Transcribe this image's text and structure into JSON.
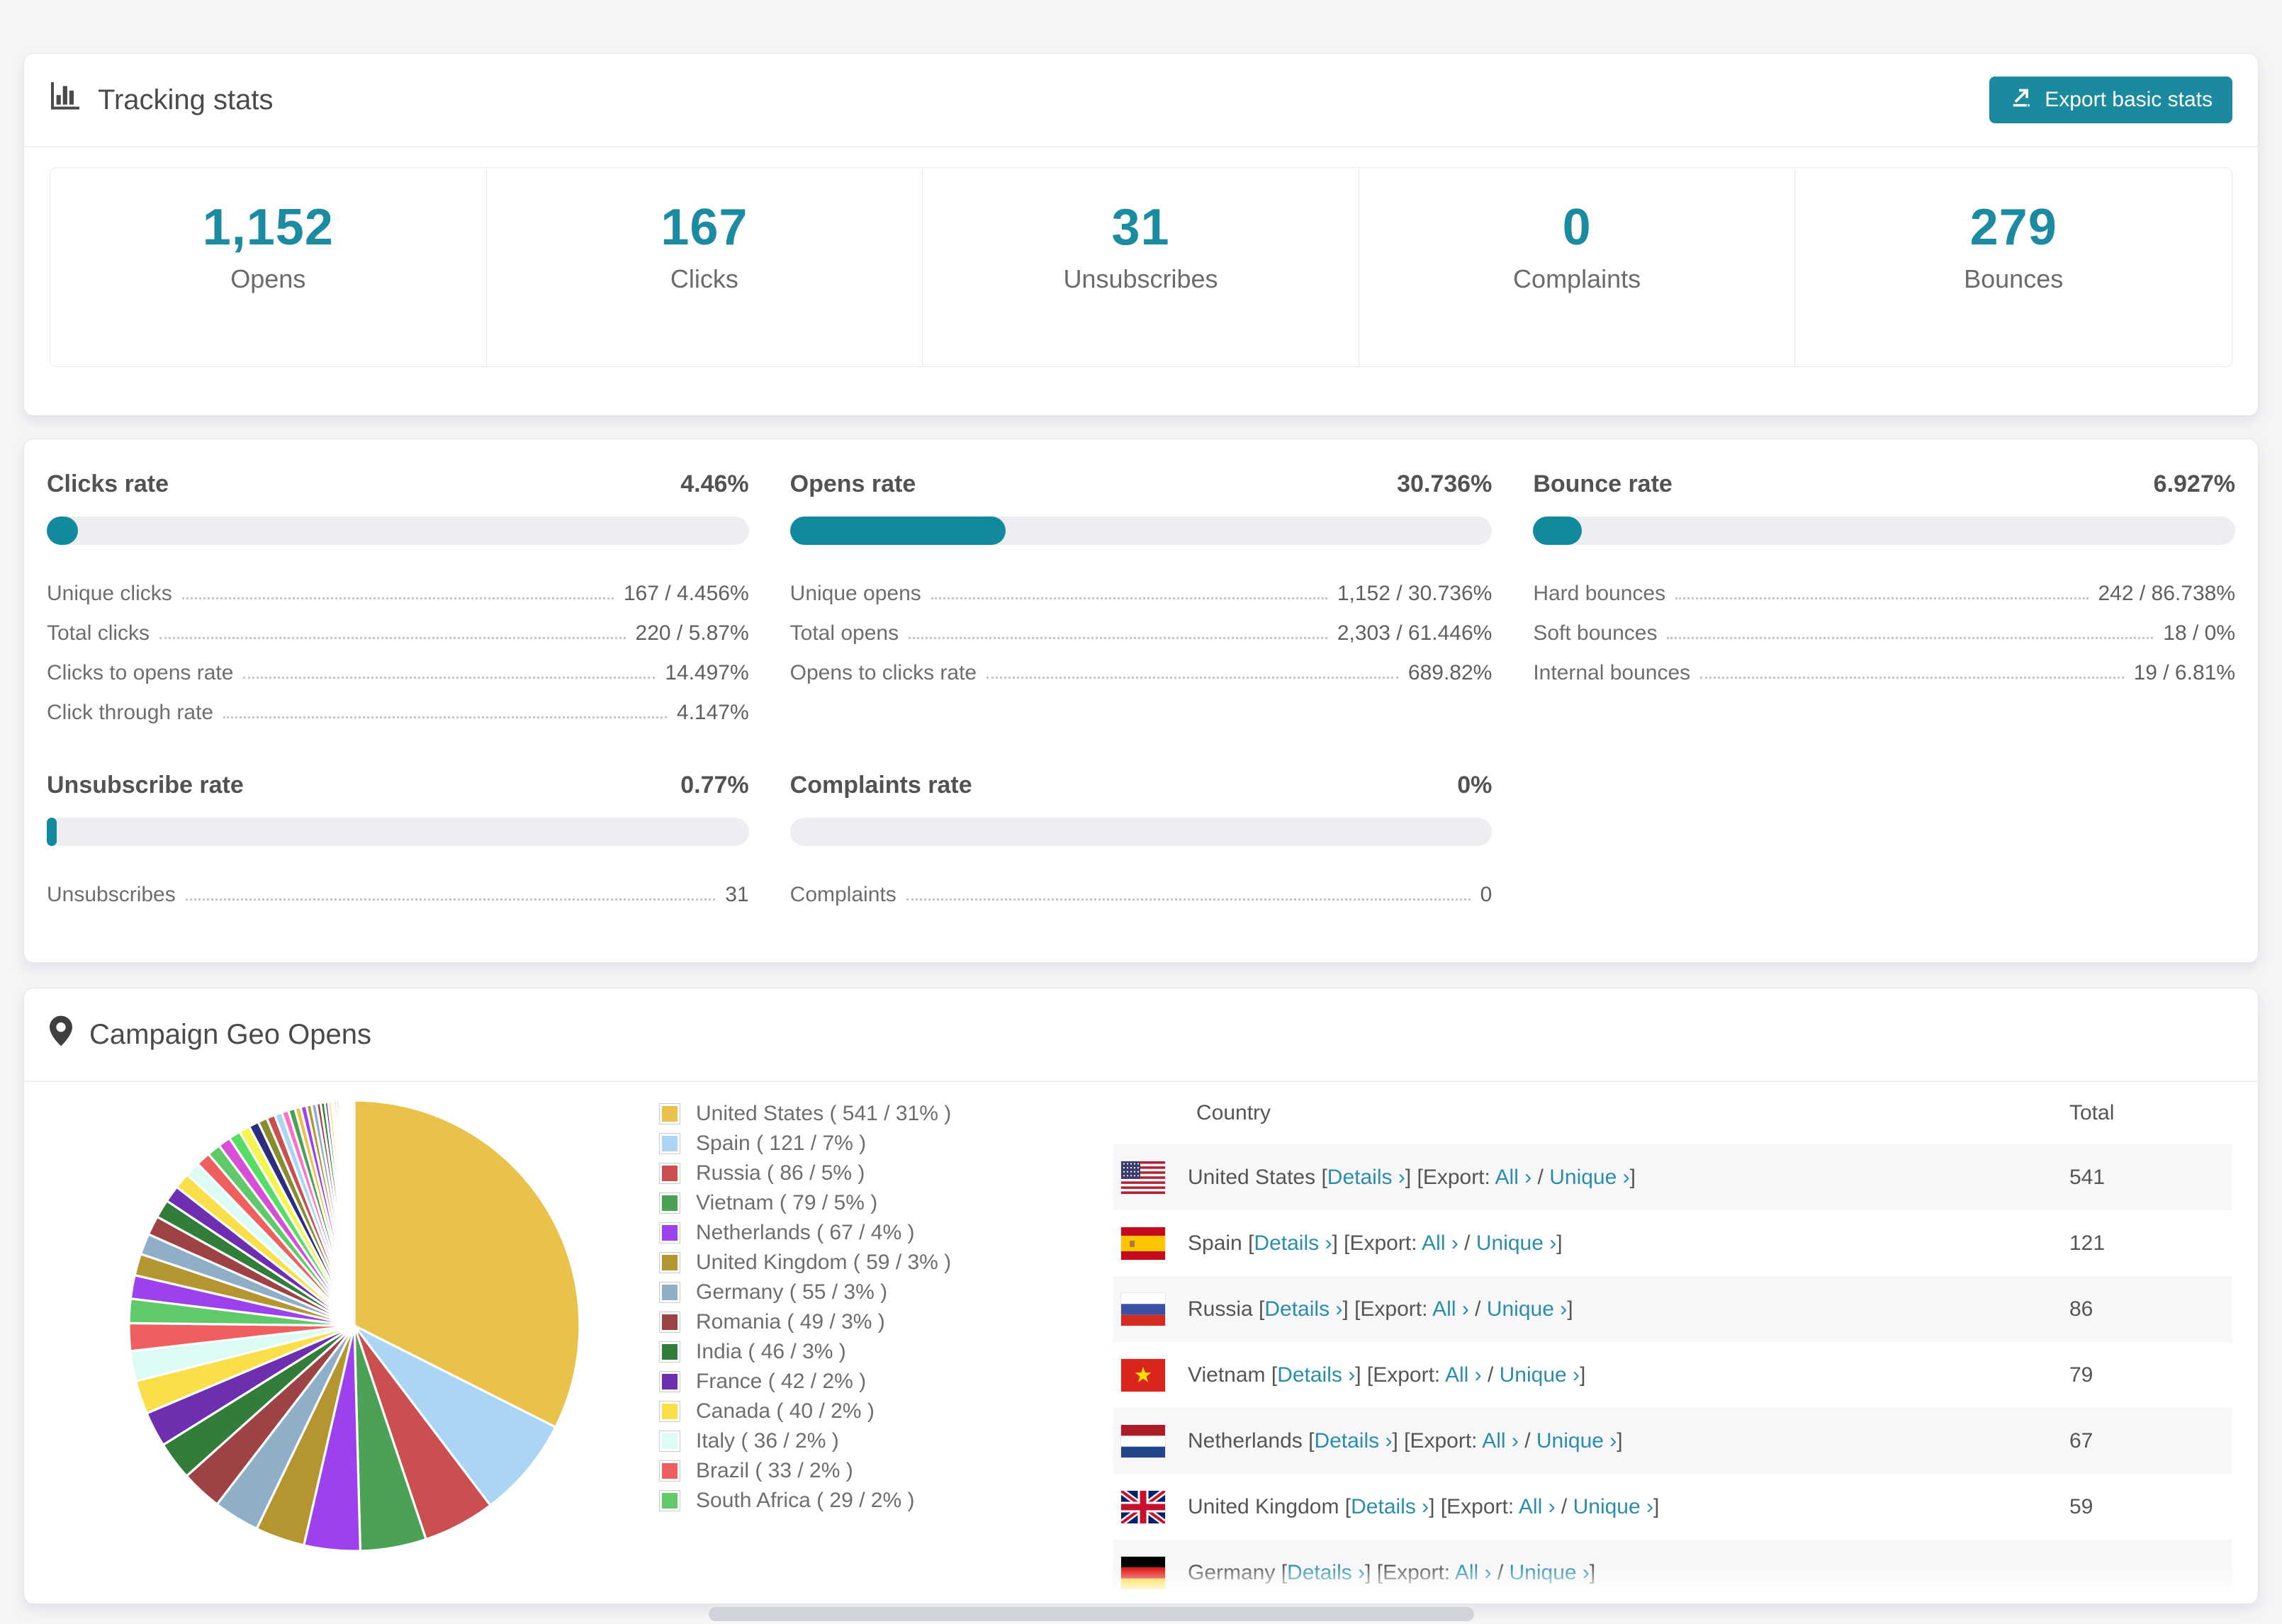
{
  "page": {
    "background": "#f5f5f6",
    "accent": "#1b8a9e",
    "stat_number_color": "#1b8ba1",
    "link_color": "#2b8dad"
  },
  "tracking": {
    "title": "Tracking stats",
    "title_icon": "bar-chart-icon",
    "export_button_label": "Export basic stats",
    "summary": [
      {
        "value": "1,152",
        "label": "Opens"
      },
      {
        "value": "167",
        "label": "Clicks"
      },
      {
        "value": "31",
        "label": "Unsubscribes"
      },
      {
        "value": "0",
        "label": "Complaints"
      },
      {
        "value": "279",
        "label": "Bounces"
      }
    ]
  },
  "rates": {
    "blocks": [
      {
        "id": "clicks-rate",
        "title": "Clicks rate",
        "value": "4.46%",
        "percent": 4.46,
        "rows": [
          {
            "label": "Unique clicks",
            "value": "167 / 4.456%"
          },
          {
            "label": "Total clicks",
            "value": "220 / 5.87%"
          },
          {
            "label": "Clicks to opens rate",
            "value": "14.497%"
          },
          {
            "label": "Click through rate",
            "value": "4.147%"
          }
        ]
      },
      {
        "id": "opens-rate",
        "title": "Opens rate",
        "value": "30.736%",
        "percent": 30.736,
        "rows": [
          {
            "label": "Unique opens",
            "value": "1,152 / 30.736%"
          },
          {
            "label": "Total opens",
            "value": "2,303 / 61.446%"
          },
          {
            "label": "Opens to clicks rate",
            "value": "689.82%"
          }
        ]
      },
      {
        "id": "bounce-rate",
        "title": "Bounce rate",
        "value": "6.927%",
        "percent": 6.927,
        "rows": [
          {
            "label": "Hard bounces",
            "value": "242 / 86.738%"
          },
          {
            "label": "Soft bounces",
            "value": "18 / 0%"
          },
          {
            "label": "Internal bounces",
            "value": "19 / 6.81%"
          }
        ]
      },
      {
        "id": "unsubscribe-rate",
        "title": "Unsubscribe rate",
        "value": "0.77%",
        "percent": 0.77,
        "rows": [
          {
            "label": "Unsubscribes",
            "value": "31"
          }
        ]
      },
      {
        "id": "complaints-rate",
        "title": "Complaints rate",
        "value": "0%",
        "percent": 0,
        "rows": [
          {
            "label": "Complaints",
            "value": "0"
          }
        ]
      }
    ]
  },
  "geo": {
    "title": "Campaign Geo Opens",
    "title_icon": "map-pin-icon",
    "legend": [
      {
        "label": "United States ( 541 / 31% )",
        "color": "#e8c24a"
      },
      {
        "label": "Spain ( 121 / 7% )",
        "color": "#abd5f5"
      },
      {
        "label": "Russia ( 86 / 5% )",
        "color": "#cb4e50"
      },
      {
        "label": "Vietnam ( 79 / 5% )",
        "color": "#4ba257"
      },
      {
        "label": "Netherlands ( 67 / 4% )",
        "color": "#9d41ee"
      },
      {
        "label": "United Kingdom ( 59 / 3% )",
        "color": "#b5952f"
      },
      {
        "label": "Germany ( 55 / 3% )",
        "color": "#8fafc8"
      },
      {
        "label": "Romania ( 49 / 3% )",
        "color": "#9e4345"
      },
      {
        "label": "India ( 46 / 3% )",
        "color": "#337d3a"
      },
      {
        "label": "France ( 42 / 2% )",
        "color": "#6d2fb0"
      },
      {
        "label": "Canada ( 40 / 2% )",
        "color": "#f9e04b"
      },
      {
        "label": "Italy ( 36 / 2% )",
        "color": "#dcfbf4"
      },
      {
        "label": "Brazil ( 33 / 2% )",
        "color": "#f05f5f"
      },
      {
        "label": "South Africa ( 29 / 2% )",
        "color": "#60c96a"
      }
    ],
    "table": {
      "headers": [
        "Country",
        "Total"
      ],
      "labels": {
        "open": "[",
        "close": "]",
        "details": "Details ›",
        "export": "Export:",
        "all": "All ›",
        "slash": "/",
        "unique": "Unique ›"
      },
      "rows": [
        {
          "country": "United States",
          "flag": "us",
          "total": "541"
        },
        {
          "country": "Spain",
          "flag": "es",
          "total": "121"
        },
        {
          "country": "Russia",
          "flag": "ru",
          "total": "86"
        },
        {
          "country": "Vietnam",
          "flag": "vn",
          "total": "79"
        },
        {
          "country": "Netherlands",
          "flag": "nl",
          "total": "67"
        },
        {
          "country": "United Kingdom",
          "flag": "gb",
          "total": "59"
        },
        {
          "country": "Germany",
          "flag": "de",
          "total": ""
        }
      ]
    }
  },
  "chart_data": {
    "type": "pie",
    "title": "Campaign Geo Opens",
    "legend_position": "right",
    "slices": [
      {
        "label": "United States",
        "value": 541,
        "percent_label": "31%",
        "color": "#e8c24a"
      },
      {
        "label": "Spain",
        "value": 121,
        "percent_label": "7%",
        "color": "#abd5f5"
      },
      {
        "label": "Russia",
        "value": 86,
        "percent_label": "5%",
        "color": "#cb4e50"
      },
      {
        "label": "Vietnam",
        "value": 79,
        "percent_label": "5%",
        "color": "#4ba257"
      },
      {
        "label": "Netherlands",
        "value": 67,
        "percent_label": "4%",
        "color": "#9d41ee"
      },
      {
        "label": "United Kingdom",
        "value": 59,
        "percent_label": "3%",
        "color": "#b5952f"
      },
      {
        "label": "Germany",
        "value": 55,
        "percent_label": "3%",
        "color": "#8fafc8"
      },
      {
        "label": "Romania",
        "value": 49,
        "percent_label": "3%",
        "color": "#9e4345"
      },
      {
        "label": "India",
        "value": 46,
        "percent_label": "3%",
        "color": "#337d3a"
      },
      {
        "label": "France",
        "value": 42,
        "percent_label": "2%",
        "color": "#6d2fb0"
      },
      {
        "label": "Canada",
        "value": 40,
        "percent_label": "2%",
        "color": "#f9e04b"
      },
      {
        "label": "Italy",
        "value": 36,
        "percent_label": "2%",
        "color": "#dcfbf4"
      },
      {
        "label": "Brazil",
        "value": 33,
        "percent_label": "2%",
        "color": "#f05f5f"
      },
      {
        "label": "South Africa",
        "value": 29,
        "percent_label": "2%",
        "color": "#60c96a"
      }
    ],
    "other_slices_values": [
      28,
      26,
      25,
      23,
      22,
      20,
      19,
      18,
      17,
      16,
      15,
      14,
      13,
      12,
      11,
      10,
      9,
      8,
      8,
      7,
      7,
      6,
      6,
      5,
      5,
      4,
      4,
      3,
      3,
      3,
      2,
      2,
      2,
      2,
      1,
      1,
      1,
      1,
      1,
      1,
      1,
      1,
      1,
      1
    ],
    "other_slices_palette": [
      "#9d41ee",
      "#b5952f",
      "#8fafc8",
      "#9e4345",
      "#337d3a",
      "#6d2fb0",
      "#f9e04b",
      "#dcfbf4",
      "#f05f5f",
      "#60c96a",
      "#d64fd6",
      "#55dd66",
      "#f5f54f",
      "#2d2d7e",
      "#8a8a2e",
      "#cb4e50",
      "#abd5f5",
      "#ff6ec7",
      "#4ba257",
      "#e8c24a"
    ]
  }
}
